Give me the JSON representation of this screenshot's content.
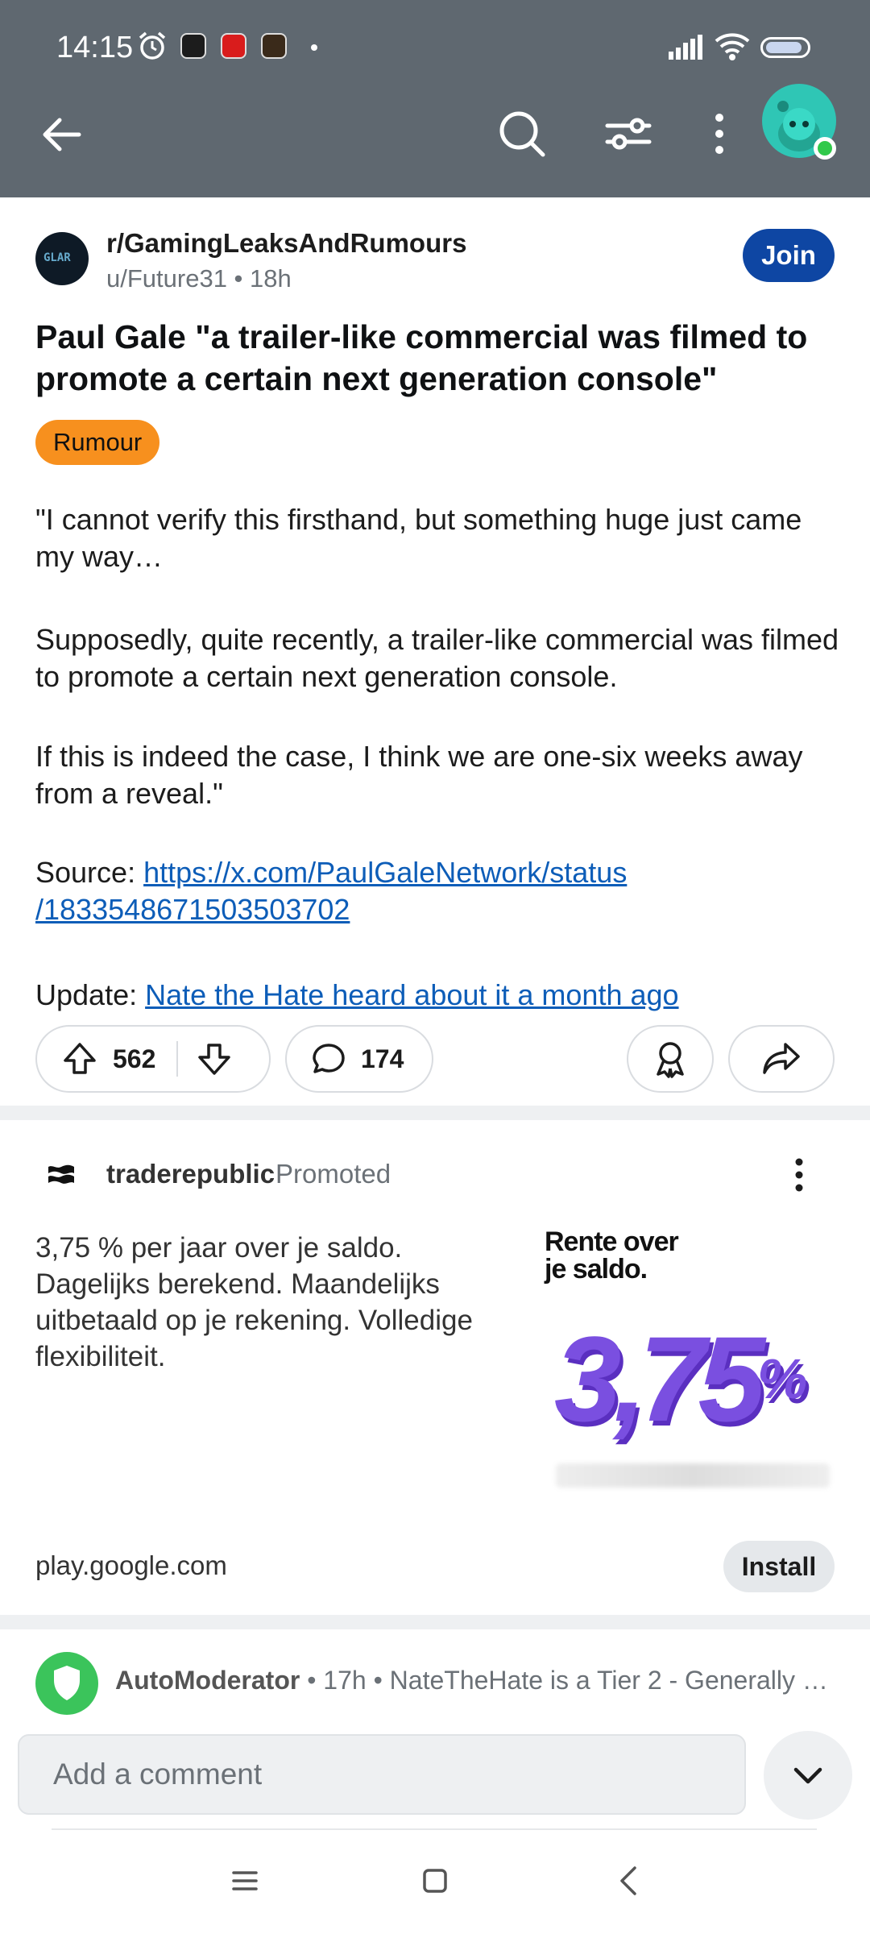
{
  "status_bar": {
    "time": "14:15"
  },
  "app_bar": {
    "back_icon": "arrow-left-icon",
    "search_icon": "search-icon",
    "filter_icon": "sort-filter-icon",
    "more_icon": "more-vertical-icon"
  },
  "post": {
    "subreddit": "r/GamingLeaksAndRumours",
    "subreddit_avatar_text": "GLAR",
    "meta": "u/Future31 • 18h",
    "join_label": "Join",
    "title": "Paul Gale \"a trailer-like commercial was filmed to promote a certain next generation console\"",
    "flair": "Rumour",
    "paragraphs": [
      "\"I cannot verify this firsthand, but something huge just came my way…",
      "Supposedly, quite recently, a trailer-like commercial was filmed to promote a certain next generation console.",
      "If this is indeed the case, I think we are one-six weeks away from a reveal.\""
    ],
    "source_label": "Source: ",
    "source_link_line1": "https://x.com/PaulGaleNetwork/status",
    "source_link_line2": "/1833548671503503702",
    "update_label": "Update: ",
    "update_link": "Nate the Hate heard about it a month ago ",
    "upvotes": "562",
    "comments": "174"
  },
  "ad": {
    "advertiser": "traderepublic",
    "promoted_label": "Promoted",
    "text": "3,75 % per jaar over je saldo. Dagelijks berekend. Maandelijks uitbetaald op je rekening. Volledige flexibiliteit.",
    "image_title_line1": "Rente over",
    "image_title_line2": "je saldo.",
    "image_rate": "3,75",
    "image_rate_unit": "%",
    "domain": "play.google.com",
    "install_label": "Install"
  },
  "automod": {
    "name": "AutoModerator",
    "meta": " • 17h • NateTheHate is a Tier 2 - Generally …"
  },
  "comment_bar": {
    "placeholder": "Add a comment"
  },
  "colors": {
    "app_bar": "#5f6870",
    "join": "#0e46a3",
    "flair": "#f7901e",
    "link": "#0d5db8",
    "automod": "#3bc45b"
  }
}
